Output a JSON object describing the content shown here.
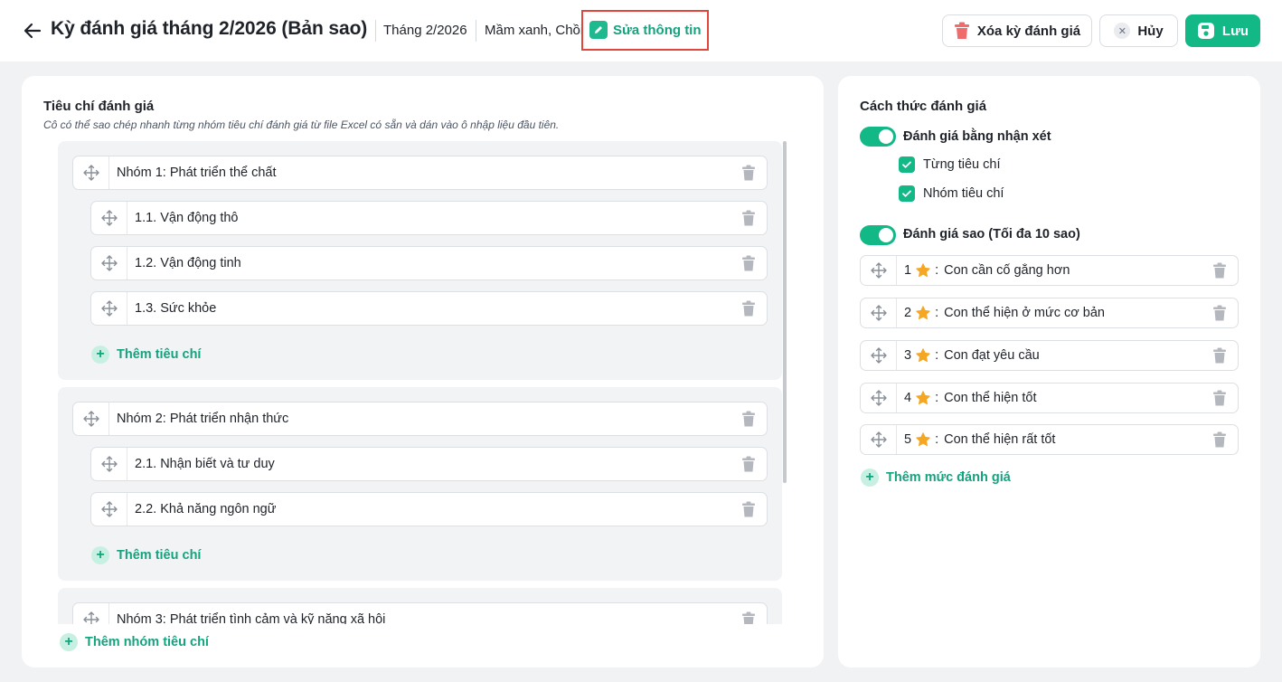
{
  "header": {
    "title": "Kỳ đánh giá tháng 2/2026 (Bản sao)",
    "month": "Tháng 2/2026",
    "classes": "Mầm xanh, Chồi",
    "edit_label": "Sửa thông tin",
    "delete_label": "Xóa kỳ đánh giá",
    "cancel_label": "Hủy",
    "save_label": "Lưu"
  },
  "criteria": {
    "title": "Tiêu chí đánh giá",
    "subtitle": "Cô có thể sao chép nhanh từng nhóm tiêu chí đánh giá từ file Excel có sẵn và dán vào ô nhập liệu đầu tiên.",
    "groups": [
      {
        "name": "Nhóm 1: Phát triển thể chất",
        "items": [
          "1.1. Vận động thô",
          "1.2. Vận động tinh",
          "1.3. Sức khỏe"
        ]
      },
      {
        "name": "Nhóm 2: Phát triển nhận thức",
        "items": [
          "2.1. Nhận biết và tư duy",
          "2.2. Khả năng ngôn ngữ"
        ]
      },
      {
        "name": "Nhóm 3: Phát triển tình cảm và kỹ năng xã hội",
        "items": []
      }
    ],
    "add_criterion_label": "Thêm tiêu chí",
    "add_group_label": "Thêm nhóm tiêu chí"
  },
  "method": {
    "title": "Cách thức đánh giá",
    "comment_toggle_label": "Đánh giá bằng nhận xét",
    "comment_toggle_on": true,
    "checkboxes": [
      {
        "label": "Từng tiêu chí",
        "checked": true
      },
      {
        "label": "Nhóm tiêu chí",
        "checked": true
      }
    ],
    "star_toggle_label": "Đánh giá sao (Tối đa 10 sao)",
    "star_toggle_on": true,
    "levels": [
      {
        "num": "1",
        "text": "Con cần cố gắng hơn"
      },
      {
        "num": "2",
        "text": "Con thể hiện ở mức cơ bản"
      },
      {
        "num": "3",
        "text": "Con đạt yêu cầu"
      },
      {
        "num": "4",
        "text": "Con thể hiện tốt"
      },
      {
        "num": "5",
        "text": "Con thể hiện rất tốt"
      }
    ],
    "add_level_label": "Thêm mức đánh giá"
  },
  "colors": {
    "accent": "#12b886",
    "highlight": "#e0463c",
    "star": "#f5a623",
    "trash": "#b4b8be"
  }
}
